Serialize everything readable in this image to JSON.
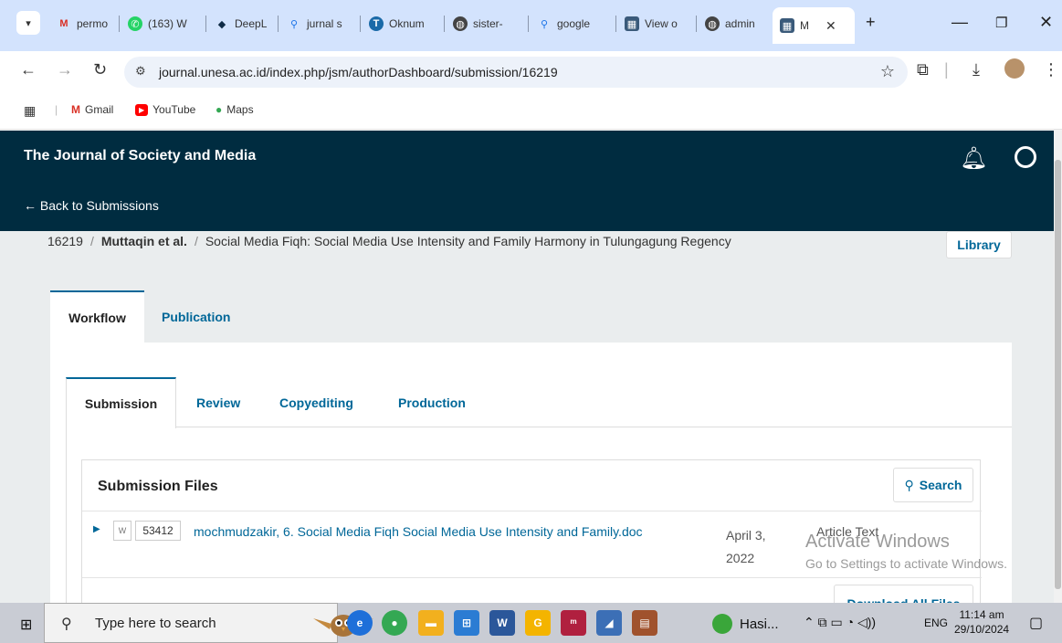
{
  "browser": {
    "tabs": [
      {
        "label": "permo",
        "icon": "gmail-icon"
      },
      {
        "label": "(163) W",
        "icon": "whatsapp-icon"
      },
      {
        "label": "DeepL",
        "icon": "deepl-icon"
      },
      {
        "label": "jurnal s",
        "icon": "search-icon"
      },
      {
        "label": "Oknum",
        "icon": "oknum-icon"
      },
      {
        "label": "sister-",
        "icon": "globe-icon"
      },
      {
        "label": "google",
        "icon": "search-icon"
      },
      {
        "label": "View o",
        "icon": "journal-icon"
      },
      {
        "label": "admin",
        "icon": "globe-icon"
      },
      {
        "label": "M",
        "icon": "journal-icon"
      }
    ],
    "url": "journal.unesa.ac.id/index.php/jsm/authorDashboard/submission/16219",
    "bookmarks": [
      {
        "label": "Gmail"
      },
      {
        "label": "YouTube"
      },
      {
        "label": "Maps"
      }
    ]
  },
  "ojs": {
    "journal_title": "The Journal of Society and Media",
    "back_link": "← Back to Submissions",
    "breadcrumb": {
      "id": "16219",
      "authors": "Muttaqin et al.",
      "title": "Social Media Fiqh: Social Media Use Intensity and Family Harmony in Tulungagung Regency"
    },
    "library_button": "Library",
    "primary_tabs": [
      "Workflow",
      "Publication"
    ],
    "stage_tabs": [
      "Submission",
      "Review",
      "Copyediting",
      "Production"
    ],
    "files_panel": {
      "title": "Submission Files",
      "search_label": "Search",
      "files": [
        {
          "id": "53412",
          "name": "mochmudzakir, 6. Social Media Fiqh Social Media Use Intensity and Family.doc",
          "date_line1": "April 3,",
          "date_line2": "2022",
          "type": "Article Text"
        }
      ],
      "download_all_label": "Download All Files"
    }
  },
  "watermark": {
    "line1": "Activate Windows",
    "line2": "Go to Settings to activate Windows."
  },
  "taskbar": {
    "search_placeholder": "Type here to search",
    "active_app_label": "Hasi...",
    "language": "ENG",
    "time": "11:14 am",
    "date": "29/10/2024"
  },
  "colors": {
    "header_bg": "#002c40",
    "link": "#006798",
    "tabstrip_bg": "#d3e3fd"
  }
}
